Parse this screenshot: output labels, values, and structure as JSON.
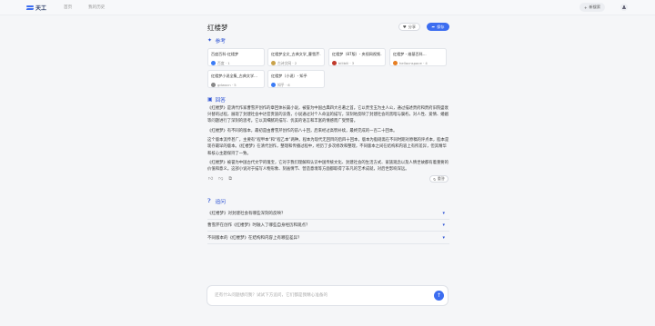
{
  "header": {
    "logo_text": "天工",
    "nav": [
      "首页",
      "我的历史"
    ],
    "new_search_label": "新搜索"
  },
  "page": {
    "title": "红楼梦",
    "share_label": "分享",
    "save_label": "保存"
  },
  "references": {
    "heading": "参考",
    "items": [
      {
        "title": "百度百科-红楼梦",
        "source": "百度 · 1",
        "color": "#3a7bf5"
      },
      {
        "title": "红楼梦全文_古典文学_曹雪芹...",
        "source": "古诗文网 · 2",
        "color": "#c9a24a"
      },
      {
        "title": "红楼梦（87版）- 央视网视频...",
        "source": "bilibili · 3",
        "color": "#c0392b"
      },
      {
        "title": "红楼梦 - 维基百科...",
        "source": "hellocnspace · 4",
        "color": "#e67e22"
      },
      {
        "title": "红楼梦小说全集_古典文学...",
        "source": "gdwxcn · 5",
        "color": "#888888"
      },
      {
        "title": "红楼梦（小说）- 知乎",
        "source": "知乎 · 6",
        "color": "#3a7bf5"
      }
    ]
  },
  "answer": {
    "heading": "回答",
    "paragraphs": [
      "《红楼梦》是清代作家曹雪芹创作的章回体长篇小说，被誉为中国古典四大名著之首。它以贾宝玉为主人公，通过描述贾府和贾府旧院盛衰兴替的过程，展现了封建社会中达官贵族的没落，小说通过对个人命运的描写，深刻地反映了封建社会的黑暗与腐朽，对人性、爱情、婚姻等问题进行了深刻的思考。它以其细腻的描写、优美的语言和丰富的情感而广受赞誉。",
      "《红楼梦》有不同的版本，最初是由曹雪芹创作的前八十回，后来经过高鹗补续，最终完成的一百二十回本。",
      "这个版本流传甚广，主要有“程甲本”和“程乙本”两种。程本为现代无回目的后四十回本，版本为脂砚斋在不同时期对原稿的评点本，脂本是现存最早的版本。《红楼梦》在清代创作，整理和传播过程中，经历了多次修改和整理，不同版本之间在结构和内容上有所差异，但其精华和核心主题保持了一致。",
      "《红楼梦》被誉为中国古代文学的瑰宝，它对于我们理解和认识中国传统文化、封建社会的生活方式、家族观念以及人情世故都有着重要的价值和意义。这部小说对于描写人物形象、刻画情节、营造意境等方面都取得了非凡的艺术成就，对后世影响深远。"
    ]
  },
  "actions": {
    "redo_label": "重答"
  },
  "follow_up": {
    "heading": "追问",
    "questions": [
      "《红楼梦》对封建社会有哪些深刻的反映？",
      "曹雪芹在创作《红楼梦》时融入了哪些自身经历和观点？",
      "不同版本的《红楼梦》在结构和内容上有哪些差异？"
    ]
  },
  "input": {
    "placeholder": "还有什么问题想问我？试试下方追问，它们都是我精心准备的"
  }
}
